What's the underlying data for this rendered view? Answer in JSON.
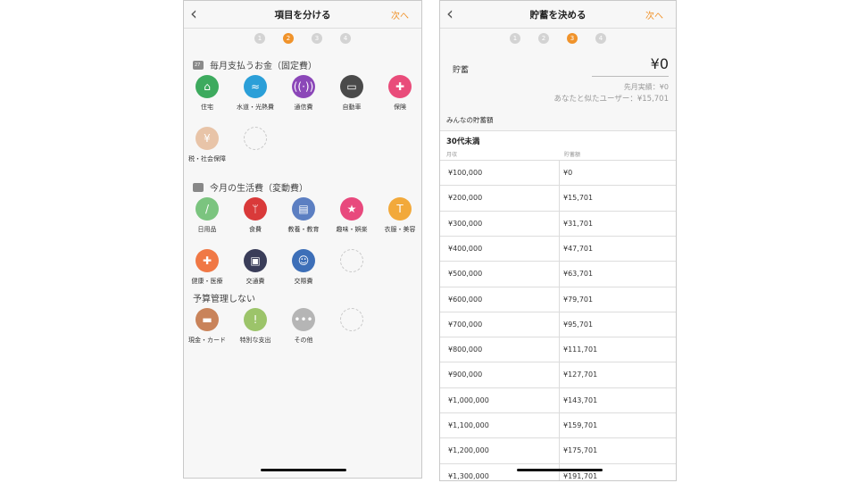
{
  "left_screen": {
    "title": "項目を分ける",
    "back": "‹",
    "next": "次へ",
    "steps": [
      "1",
      "2",
      "3",
      "4"
    ],
    "active_step": 2,
    "fixed_section_title": "毎月支払うお金（固定費）",
    "fixed_items": [
      {
        "label": "住宅",
        "icon": "house-icon",
        "glyph": "⌂",
        "color": "#3daa5e"
      },
      {
        "label": "水道・光熱費",
        "icon": "faucet-icon",
        "glyph": "≈",
        "color": "#2b9fd8"
      },
      {
        "label": "通信費",
        "icon": "antenna-icon",
        "glyph": "((·))",
        "color": "#8b47b8"
      },
      {
        "label": "自動車",
        "icon": "car-icon",
        "glyph": "▭",
        "color": "#4a4a4a"
      },
      {
        "label": "保険",
        "icon": "medical-kit-icon",
        "glyph": "✚",
        "color": "#e94c7a"
      },
      {
        "label": "税・社会保障",
        "icon": "money-icon",
        "glyph": "¥",
        "color": "#e8c4a8"
      }
    ],
    "variable_section_title": "今月の生活費（変動費）",
    "variable_items": [
      {
        "label": "日用品",
        "icon": "toothbrush-icon",
        "glyph": "/",
        "color": "#7bc47f"
      },
      {
        "label": "食費",
        "icon": "fork-knife-icon",
        "glyph": "ᛘ",
        "color": "#d93a3a"
      },
      {
        "label": "教養・教育",
        "icon": "book-icon",
        "glyph": "▤",
        "color": "#5c7fc2"
      },
      {
        "label": "趣味・娯楽",
        "icon": "star-icon",
        "glyph": "★",
        "color": "#e8497d"
      },
      {
        "label": "衣服・美容",
        "icon": "shirt-icon",
        "glyph": "T",
        "color": "#f2a93b"
      },
      {
        "label": "健康・医療",
        "icon": "cross-icon",
        "glyph": "✚",
        "color": "#f07845"
      },
      {
        "label": "交通費",
        "icon": "train-icon",
        "glyph": "▣",
        "color": "#3a3d59"
      },
      {
        "label": "交際費",
        "icon": "people-icon",
        "glyph": "☺",
        "color": "#3d6fb8"
      }
    ],
    "unbudgeted_section_title": "予算管理しない",
    "unbudgeted_items": [
      {
        "label": "現金・カード",
        "icon": "wallet-icon",
        "glyph": "▬",
        "color": "#c9835a"
      },
      {
        "label": "特別な支出",
        "icon": "exclamation-icon",
        "glyph": "!",
        "color": "#9cc46a"
      },
      {
        "label": "その他",
        "icon": "more-dots-icon",
        "glyph": "•••",
        "color": "#b5b5b5"
      }
    ]
  },
  "right_screen": {
    "title": "貯蓄を決める",
    "back": "‹",
    "next": "次へ",
    "steps": [
      "1",
      "2",
      "3",
      "4"
    ],
    "active_step": 3,
    "savings_label": "貯蓄",
    "savings_value": "¥0",
    "prev_result": "先月実績：¥0",
    "similar_users": "あなたと似たユーザー：¥15,701",
    "everyone_label": "みんなの貯蓄額",
    "age_group": "30代未満",
    "col_income": "月収",
    "col_savings": "貯蓄額",
    "rows": [
      {
        "income": "¥100,000",
        "savings": "¥0"
      },
      {
        "income": "¥200,000",
        "savings": "¥15,701"
      },
      {
        "income": "¥300,000",
        "savings": "¥31,701"
      },
      {
        "income": "¥400,000",
        "savings": "¥47,701"
      },
      {
        "income": "¥500,000",
        "savings": "¥63,701"
      },
      {
        "income": "¥600,000",
        "savings": "¥79,701"
      },
      {
        "income": "¥700,000",
        "savings": "¥95,701"
      },
      {
        "income": "¥800,000",
        "savings": "¥111,701"
      },
      {
        "income": "¥900,000",
        "savings": "¥127,701"
      },
      {
        "income": "¥1,000,000",
        "savings": "¥143,701"
      },
      {
        "income": "¥1,100,000",
        "savings": "¥159,701"
      },
      {
        "income": "¥1,200,000",
        "savings": "¥175,701"
      },
      {
        "income": "¥1,300,000",
        "savings": "¥191,701"
      }
    ]
  }
}
